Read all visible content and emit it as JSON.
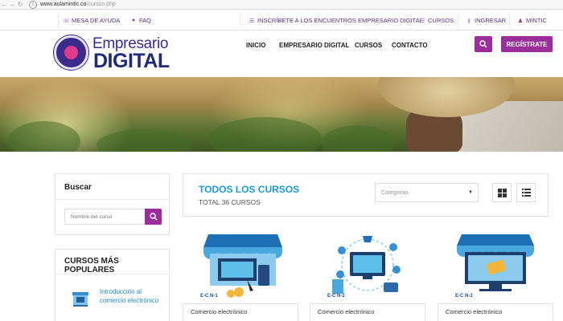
{
  "browser": {
    "url_host": "www.aulamintic.co",
    "url_path": "/cursos.php"
  },
  "topbar": {
    "help_desk": "MESA DE AYUDA",
    "faq": "FAQ",
    "signup_events": "INSCRÍBETE A LOS ENCUENTROS EMPRESARIO DIGITAL",
    "courses": "CURSOS",
    "login": "INGRESAR",
    "mintic": "MINTIC"
  },
  "header": {
    "logo_line1": "Empresario",
    "logo_line2": "DIGITAL",
    "nav": [
      "INICIO",
      "EMPRESARIO DIGITAL",
      "CURSOS",
      "CONTACTO"
    ],
    "register_label": "REGÍSTRATE"
  },
  "sidebar": {
    "search_title": "Buscar",
    "search_placeholder": "Nombre del curso",
    "popular_title": "CURSOS MÁS POPULARES",
    "popular_items": [
      {
        "label": "Introducción al comercio electrónico"
      }
    ]
  },
  "courses": {
    "title": "TODOS LOS CURSOS",
    "total": "TOTAL 36 CURSOS",
    "category_placeholder": "Categorias",
    "cards": [
      {
        "code": "E-C N-1",
        "label": "Comercio electrónico"
      },
      {
        "code": "E-C N-2",
        "label": "Comercio electrónico"
      },
      {
        "code": "E-C N-3",
        "label": "Comercio electrónico"
      }
    ]
  },
  "colors": {
    "brand_purple": "#9b2e9c",
    "link_blue": "#1b9ad6",
    "navy": "#1f2a78"
  }
}
